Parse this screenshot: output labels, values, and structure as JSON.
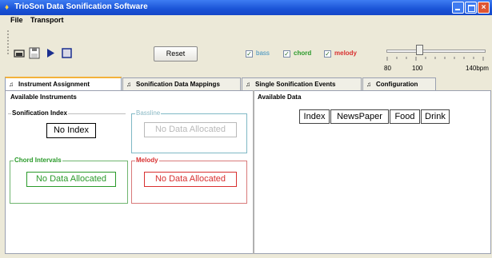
{
  "window": {
    "title": "TrioSon Data Sonification Software",
    "controls": [
      "minimize",
      "maximize",
      "close"
    ]
  },
  "menubar": {
    "items": [
      "File",
      "Transport"
    ]
  },
  "toolbar": {
    "icons": [
      "folder-open-icon",
      "floppy-save-icon",
      "play-icon",
      "stop-icon"
    ],
    "reset_label": "Reset",
    "checkboxes": [
      {
        "label": "bass",
        "checked": true,
        "color": "#3A8FBF"
      },
      {
        "label": "chord",
        "checked": true,
        "color": "#2A9A2A"
      },
      {
        "label": "melody",
        "checked": true,
        "color": "#D83030"
      }
    ],
    "tempo": {
      "tick_labels": [
        "80",
        "100",
        "140bpm"
      ],
      "value": 100
    }
  },
  "tabs": [
    {
      "label": "Instrument Assignment",
      "active": true
    },
    {
      "label": "Sonification Data Mappings",
      "active": false
    },
    {
      "label": "Single Sonification Events",
      "active": false
    },
    {
      "label": "Configuration",
      "active": false
    }
  ],
  "instruments": {
    "heading": "Available Instruments",
    "sonification_index": {
      "label": "Sonification Index",
      "value": "No Index"
    },
    "bassline": {
      "label": "Bassline",
      "value": "No Data Allocated"
    },
    "chord_intervals": {
      "label": "Chord Intervals",
      "value": "No Data Allocated"
    },
    "melody": {
      "label": "Melody",
      "value": "No Data Allocated"
    }
  },
  "data": {
    "heading": "Available Data",
    "items": [
      "Index",
      "NewsPaper",
      "Food",
      "Drink"
    ]
  },
  "colors": {
    "title_bar": "#1A53D6",
    "bass": "#7FB8C5",
    "chord": "#2A9A2A",
    "melody": "#D83030"
  }
}
